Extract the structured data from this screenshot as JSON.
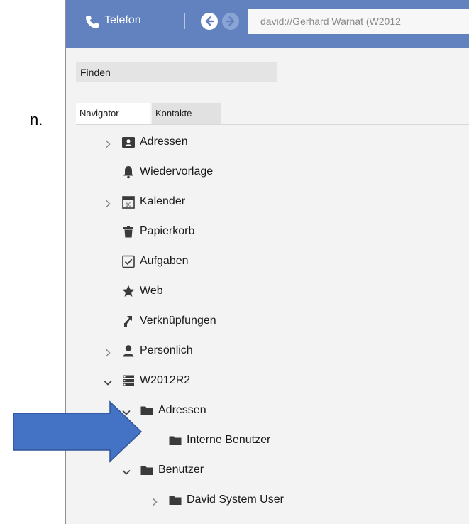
{
  "background_fragment": "n.",
  "toolbar": {
    "phone_label": "Telefon",
    "address_text": "david://Gerhard Warnat (W2012"
  },
  "search": {
    "value": "Finden"
  },
  "tabs": [
    {
      "label": "Navigator",
      "active": true
    },
    {
      "label": "Kontakte",
      "active": false
    }
  ],
  "tree": [
    {
      "label": "Adressen",
      "icon": "address-book-icon",
      "expander": "collapsed",
      "level": 0
    },
    {
      "label": "Wiedervorlage",
      "icon": "bell-icon",
      "expander": "none",
      "level": 0
    },
    {
      "label": "Kalender",
      "icon": "calendar-icon",
      "expander": "collapsed",
      "level": 0
    },
    {
      "label": "Papierkorb",
      "icon": "trash-icon",
      "expander": "none",
      "level": 0
    },
    {
      "label": "Aufgaben",
      "icon": "checkbox-icon",
      "expander": "none",
      "level": 0
    },
    {
      "label": "Web",
      "icon": "star-icon",
      "expander": "none",
      "level": 0
    },
    {
      "label": "Verknüpfungen",
      "icon": "link-icon",
      "expander": "none",
      "level": 0
    },
    {
      "label": "Persönlich",
      "icon": "person-icon",
      "expander": "collapsed",
      "level": 0
    },
    {
      "label": "W2012R2",
      "icon": "server-icon",
      "expander": "expanded",
      "level": 0
    },
    {
      "label": "Adressen",
      "icon": "folder-icon",
      "expander": "expanded",
      "level": 1
    },
    {
      "label": "Interne Benutzer",
      "icon": "folder-icon",
      "expander": "none",
      "level": 2
    },
    {
      "label": "Benutzer",
      "icon": "folder-icon",
      "expander": "expanded",
      "level": 1
    },
    {
      "label": "David System User",
      "icon": "folder-icon",
      "expander": "collapsed",
      "level": 2
    }
  ],
  "colors": {
    "titlebar": "#6282bf",
    "panel": "#f3f3f3",
    "annotation_arrow": "#4472c4"
  }
}
